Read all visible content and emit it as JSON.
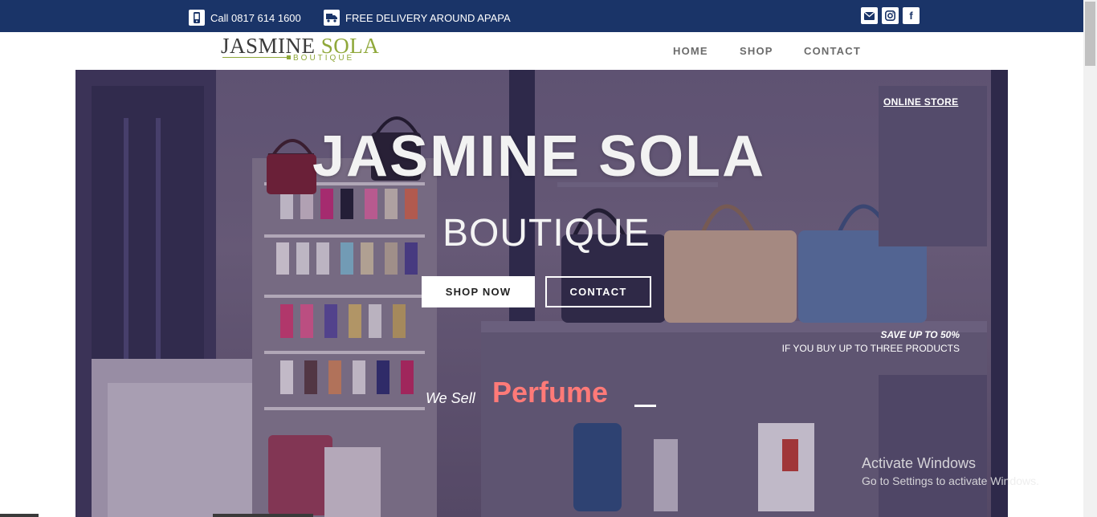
{
  "topbar": {
    "phone_text": "Call 0817 614 1600",
    "delivery_text": "FREE DELIVERY AROUND APAPA",
    "phone_icon": "phone-icon",
    "delivery_icon": "truck-icon",
    "social": [
      {
        "icon": "envelope-icon"
      },
      {
        "icon": "instagram-icon"
      },
      {
        "icon": "facebook-icon",
        "glyph": "f"
      }
    ],
    "bg_color": "#1a3468"
  },
  "logo": {
    "word1": "JASMINE",
    "word2": "SOLA",
    "sub": "BOUTIQUE",
    "accent_color": "#8fa83a"
  },
  "nav": {
    "items": [
      "HOME",
      "SHOP",
      "CONTACT"
    ]
  },
  "hero": {
    "online_store": "ONLINE STORE",
    "title": "JASMINE SOLA",
    "subtitle": "BOUTIQUE",
    "shop_now": "SHOP NOW",
    "contact": "CONTACT",
    "save_title": "SAVE UP TO 50%",
    "save_sub": "IF YOU BUY UP TO THREE PRODUCTS",
    "we_sell": "We Sell",
    "rotating_word": "Perfume",
    "rotating_color": "#ff7a78"
  },
  "watermark": {
    "title": "Activate Windows",
    "sub": "Go to Settings to activate Windows."
  }
}
